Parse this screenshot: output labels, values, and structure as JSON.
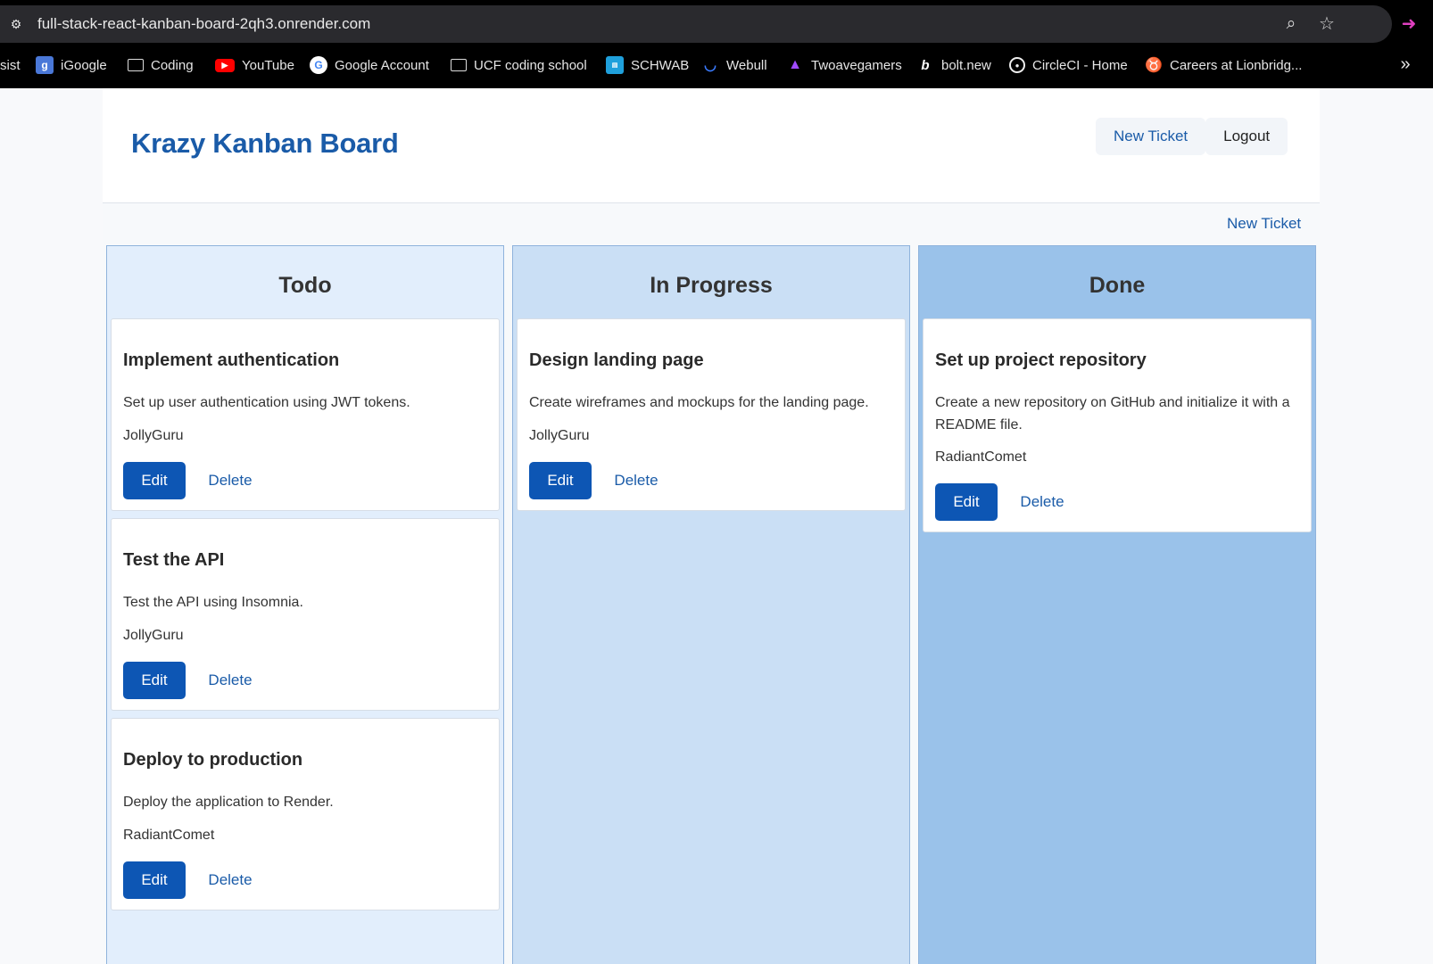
{
  "browser": {
    "url": "full-stack-react-kanban-board-2qh3.onrender.com",
    "bookmarks": [
      {
        "label": "sist",
        "icon": "none"
      },
      {
        "label": "iGoogle",
        "icon": "igoogle-icon"
      },
      {
        "label": "Coding",
        "icon": "folder-icon"
      },
      {
        "label": "YouTube",
        "icon": "youtube-icon"
      },
      {
        "label": "Google Account",
        "icon": "google-icon"
      },
      {
        "label": "UCF coding school",
        "icon": "folder-icon"
      },
      {
        "label": "SCHWAB",
        "icon": "schwab-icon"
      },
      {
        "label": "Webull",
        "icon": "webull-icon"
      },
      {
        "label": "Twoavegamers",
        "icon": "twoavegamers-icon"
      },
      {
        "label": "bolt.new",
        "icon": "bolt-icon"
      },
      {
        "label": "CircleCI - Home",
        "icon": "circleci-icon"
      },
      {
        "label": "Careers at Lionbridg...",
        "icon": "lionbridge-icon"
      }
    ]
  },
  "header": {
    "title": "Krazy Kanban Board",
    "new_ticket": "New Ticket",
    "logout": "Logout"
  },
  "toolbar": {
    "new_ticket": "New Ticket"
  },
  "columns": [
    {
      "title": "Todo",
      "cards": [
        {
          "title": "Implement authentication",
          "description": "Set up user authentication using JWT tokens.",
          "assignee": "JollyGuru",
          "edit": "Edit",
          "delete": "Delete"
        },
        {
          "title": "Test the API",
          "description": "Test the API using Insomnia.",
          "assignee": "JollyGuru",
          "edit": "Edit",
          "delete": "Delete"
        },
        {
          "title": "Deploy to production",
          "description": "Deploy the application to Render.",
          "assignee": "RadiantComet",
          "edit": "Edit",
          "delete": "Delete"
        }
      ]
    },
    {
      "title": "In Progress",
      "cards": [
        {
          "title": "Design landing page",
          "description": "Create wireframes and mockups for the landing page.",
          "assignee": "JollyGuru",
          "edit": "Edit",
          "delete": "Delete"
        }
      ]
    },
    {
      "title": "Done",
      "cards": [
        {
          "title": "Set up project repository",
          "description": "Create a new repository on GitHub and initialize it with a README file.",
          "assignee": "RadiantComet",
          "edit": "Edit",
          "delete": "Delete"
        }
      ]
    }
  ],
  "colors": {
    "brand": "#1a5ba8",
    "button": "#0d56b4",
    "todo_bg": "#e2eefc",
    "progress_bg": "#cadff5",
    "done_bg": "#9ac2ea"
  }
}
